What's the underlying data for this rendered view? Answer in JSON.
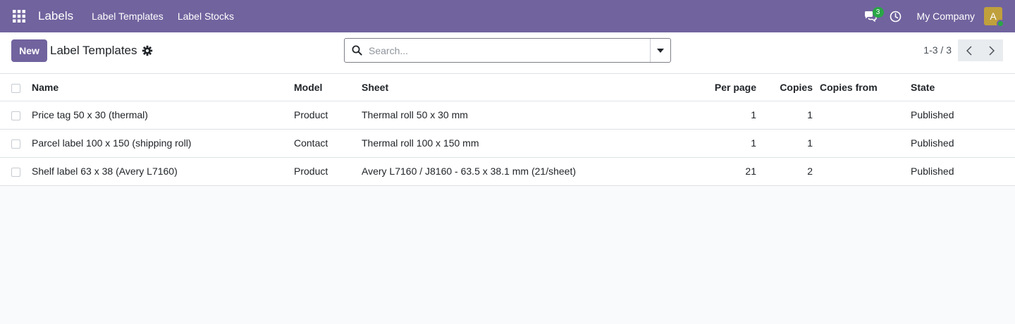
{
  "navbar": {
    "app_name": "Labels",
    "menus": [
      "Label Templates",
      "Label Stocks"
    ],
    "messages_count": "3",
    "company": "My Company",
    "avatar_initial": "A",
    "brand_color": "#71639e"
  },
  "control_panel": {
    "new_label": "New",
    "title": "Label Templates",
    "search_placeholder": "Search...",
    "pager": "1-3 / 3"
  },
  "table": {
    "columns": {
      "name": "Name",
      "model": "Model",
      "sheet": "Sheet",
      "per_page": "Per page",
      "copies": "Copies",
      "copies_from": "Copies from",
      "state": "State"
    },
    "rows": [
      {
        "name": "Price tag 50 x 30 (thermal)",
        "model": "Product",
        "sheet": "Thermal roll 50 x 30 mm",
        "per_page": "1",
        "copies": "1",
        "copies_from": "",
        "state": "Published"
      },
      {
        "name": "Parcel label 100 x 150 (shipping roll)",
        "model": "Contact",
        "sheet": "Thermal roll 100 x 150 mm",
        "per_page": "1",
        "copies": "1",
        "copies_from": "",
        "state": "Published"
      },
      {
        "name": "Shelf label 63 x 38 (Avery L7160)",
        "model": "Product",
        "sheet": "Avery L7160 / J8160 - 63.5 x 38.1 mm (21/sheet)",
        "per_page": "21",
        "copies": "2",
        "copies_from": "",
        "state": "Published"
      }
    ]
  },
  "icons": [
    "apps-grid-icon",
    "chat-icon",
    "clock-icon",
    "gear-icon",
    "search-icon",
    "caret-down-icon",
    "chevron-left-icon",
    "chevron-right-icon"
  ]
}
